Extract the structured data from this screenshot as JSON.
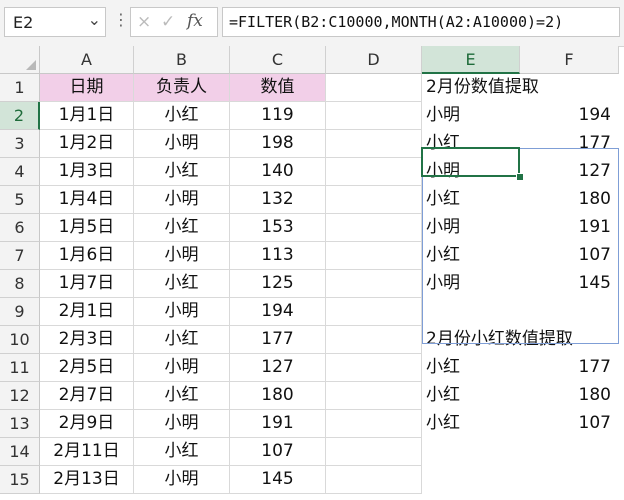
{
  "formula_bar": {
    "name_box": "E2",
    "dropdown_icon": "chevron-down",
    "more_icon": "vertical-ellipsis",
    "cancel_icon": "×",
    "enter_icon": "✓",
    "fx_label": "fx",
    "formula": "=FILTER(B2:C10000,MONTH(A2:A10000)=2)"
  },
  "columns": [
    "A",
    "B",
    "C",
    "D",
    "E",
    "F"
  ],
  "selected_column": "E",
  "selected_row": "2",
  "rows": [
    "1",
    "2",
    "3",
    "4",
    "5",
    "6",
    "7",
    "8",
    "9",
    "10",
    "11",
    "12",
    "13",
    "14",
    "15"
  ],
  "colors": {
    "header_fill": "#f2cfe8",
    "selection": "#217346",
    "spill_border": "#7f9ed6"
  },
  "table": {
    "headers": [
      "日期",
      "负责人",
      "数值"
    ],
    "data": [
      [
        "1月1日",
        "小红",
        "119"
      ],
      [
        "1月2日",
        "小明",
        "198"
      ],
      [
        "1月3日",
        "小红",
        "140"
      ],
      [
        "1月4日",
        "小明",
        "132"
      ],
      [
        "1月5日",
        "小红",
        "153"
      ],
      [
        "1月6日",
        "小明",
        "113"
      ],
      [
        "1月7日",
        "小红",
        "125"
      ],
      [
        "2月1日",
        "小明",
        "194"
      ],
      [
        "2月3日",
        "小红",
        "177"
      ],
      [
        "2月5日",
        "小明",
        "127"
      ],
      [
        "2月7日",
        "小红",
        "180"
      ],
      [
        "2月9日",
        "小明",
        "191"
      ],
      [
        "2月11日",
        "小红",
        "107"
      ],
      [
        "2月13日",
        "小明",
        "145"
      ]
    ]
  },
  "result1": {
    "title": "2月份数值提取",
    "data": [
      [
        "小明",
        "194"
      ],
      [
        "小红",
        "177"
      ],
      [
        "小明",
        "127"
      ],
      [
        "小红",
        "180"
      ],
      [
        "小明",
        "191"
      ],
      [
        "小红",
        "107"
      ],
      [
        "小明",
        "145"
      ]
    ]
  },
  "result2": {
    "title": "2月份小红数值提取",
    "data": [
      [
        "小红",
        "177"
      ],
      [
        "小红",
        "180"
      ],
      [
        "小红",
        "107"
      ]
    ]
  }
}
